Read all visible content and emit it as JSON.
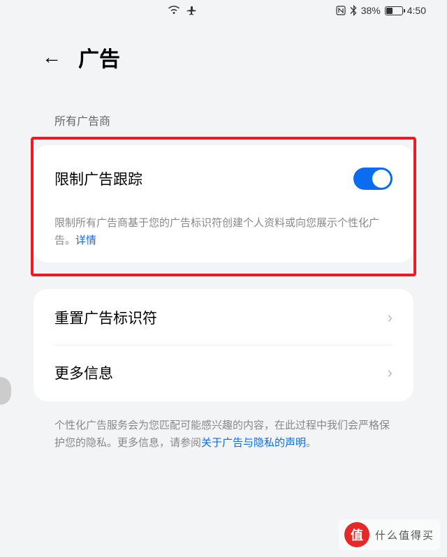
{
  "status_bar": {
    "battery_percent": "38%",
    "time": "4:50"
  },
  "header": {
    "title": "广告"
  },
  "section1": {
    "label": "所有广告商",
    "toggle_row": {
      "label": "限制广告跟踪",
      "enabled": true
    },
    "description": "限制所有广告商基于您的广告标识符创建个人资料或向您展示个性化广告。",
    "detail_link": "详情"
  },
  "section2": {
    "rows": [
      {
        "label": "重置广告标识符"
      },
      {
        "label": "更多信息"
      }
    ],
    "description": "个性化广告服务会为您匹配可能感兴趣的内容，在此过程中我们会严格保护您的隐私。更多信息，请参阅",
    "privacy_link": "关于广告与隐私的声明",
    "period": "。"
  },
  "watermark": {
    "logo": "值",
    "text": "什么值得买"
  }
}
